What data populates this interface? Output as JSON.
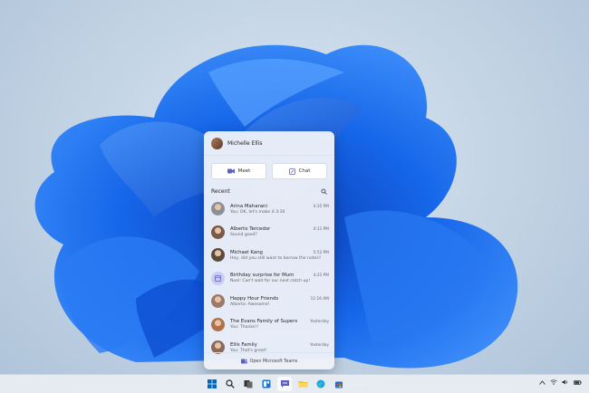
{
  "flyout": {
    "user_name": "Michelle Ellis",
    "meet_label": "Meet",
    "chat_label": "Chat",
    "recent_label": "Recent",
    "footer_label": "Open Microsoft Teams"
  },
  "conversations": [
    {
      "name": "Arina Maharani",
      "time": "4:35 PM",
      "message": "You: OK, let's make it 3:30",
      "color": "#8c8f96"
    },
    {
      "name": "Alberto Tercedor",
      "time": "4:11 PM",
      "message": "Sound good?",
      "color": "#7a5a44"
    },
    {
      "name": "Michael Kang",
      "time": "5:52 PM",
      "message": "Hey, did you still want to borrow the notes?",
      "color": "#5c4a3a"
    },
    {
      "name": "Birthday surprise for Mum",
      "time": "4:25 PM",
      "message": "Noel: Can't wait for our next catch up!",
      "color": "#c9cbf2"
    },
    {
      "name": "Happy Hour Friends",
      "time": "11:16 AM",
      "message": "Alberto: Awesome!",
      "color": "#9b7a6a"
    },
    {
      "name": "The Evans Family of Supers",
      "time": "Yesterday",
      "message": "You: Thanks!!",
      "color": "#b0704a"
    },
    {
      "name": "Ellis Family",
      "time": "Yesterday",
      "message": "You: That's great!",
      "color": "#8a6a58"
    }
  ],
  "taskbar": {
    "icons": [
      "windows-icon",
      "search-icon",
      "task-view-icon",
      "widgets-icon",
      "chat-icon",
      "file-explorer-icon",
      "edge-icon",
      "store-icon"
    ],
    "active": "chat-icon",
    "accent": "#0067c0"
  },
  "colors": {
    "accent": "#5b5fc7",
    "wallpaper_blue": "#1565e8"
  }
}
